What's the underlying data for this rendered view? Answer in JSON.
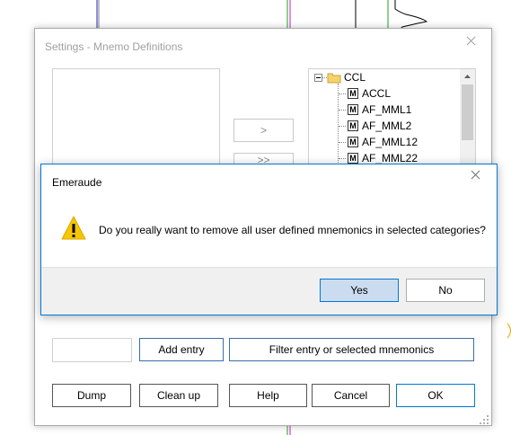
{
  "settings": {
    "title": "Settings - Mnemo Definitions",
    "arrow_right": ">",
    "arrow_right2": ">>",
    "tree": {
      "root": "CCL",
      "items": [
        "ACCL",
        "AF_MML1",
        "AF_MML2",
        "AF_MML12",
        "AF_MML22"
      ],
      "item_icon_letter": "M"
    },
    "add_entry_label": "Add entry",
    "filter_label": "Filter entry or selected mnemonics",
    "buttons": {
      "dump": "Dump",
      "clean_up": "Clean up",
      "help": "Help",
      "cancel": "Cancel",
      "ok": "OK"
    }
  },
  "dialog": {
    "title": "Emeraude",
    "message": "Do you really want to remove all user defined mnemonics in selected categories?",
    "yes_label": "Yes",
    "no_label": "No",
    "warning_glyph": "!"
  },
  "colors": {
    "accent": "#0078d7",
    "warning": "#f7c600",
    "button_bg": "#e1e1e1",
    "button_highlight": "#ccdcf0"
  }
}
